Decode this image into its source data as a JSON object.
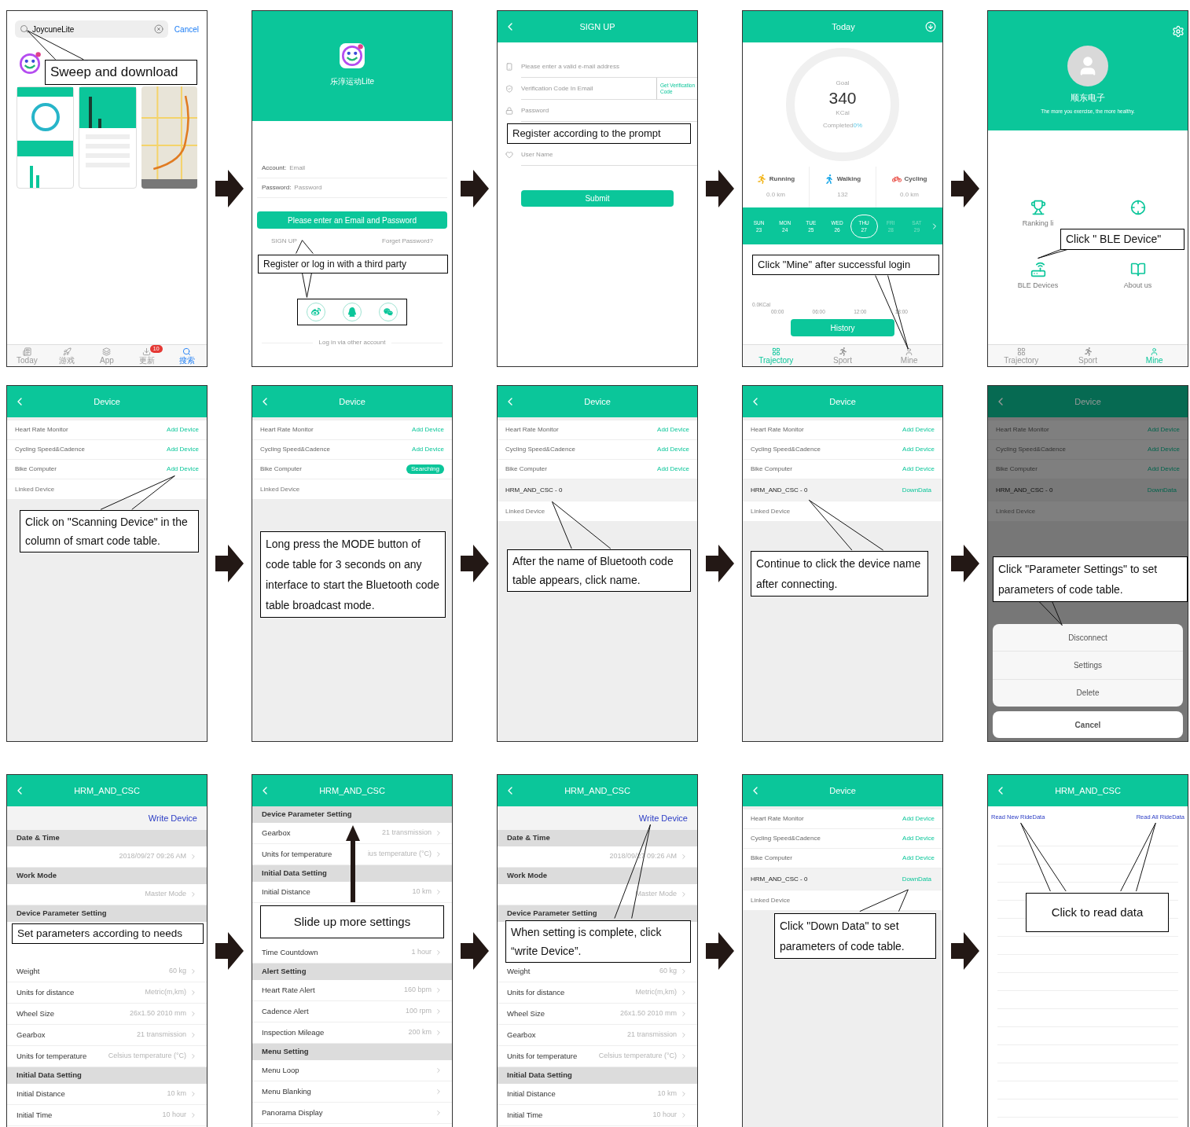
{
  "screens": [
    {
      "kind": "appstore",
      "search": {
        "value": "JoycuneLite"
      },
      "cancel": "Cancel",
      "tabs": [
        {
          "kind": "today",
          "label": "Today",
          "selected": false
        },
        {
          "kind": "games",
          "label": "游戏",
          "selected": false
        },
        {
          "kind": "apps",
          "label": "App",
          "selected": false
        },
        {
          "kind": "updates",
          "label": "更新",
          "badge": "10",
          "selected": false
        },
        {
          "kind": "search",
          "label": "搜索",
          "selected": true
        }
      ],
      "callout": "Sweep and download"
    },
    {
      "kind": "login",
      "app_name": "乐淳运动Lite",
      "fields": [
        {
          "label": "Account:",
          "placeholder": "Email"
        },
        {
          "label": "Password:",
          "placeholder": "Password"
        }
      ],
      "button": "Please enter an Email and Password",
      "links": [
        "SIGN UP",
        "Forget Password?"
      ],
      "footer": "Log in via other account",
      "callout": "Register or log in with a third party"
    },
    {
      "kind": "signup",
      "title": "SIGN UP",
      "fields": [
        {
          "kind": "email",
          "placeholder": "Please enter a valid e-mail address"
        },
        {
          "kind": "code",
          "placeholder": "Verification Code In Email",
          "action": "Get Verification Code"
        },
        {
          "kind": "password",
          "placeholder": "Password"
        },
        {
          "kind": "covered"
        },
        {
          "kind": "name",
          "placeholder": "User Name"
        }
      ],
      "button": "Submit",
      "callout": "Register according to the prompt"
    },
    {
      "kind": "today",
      "title": "Today",
      "goal_label": "Goal",
      "goal": "340",
      "unit": "KCal",
      "completed_label": "Completed",
      "completed": "0%",
      "stats": [
        {
          "kind": "running",
          "label": "Running",
          "value": "0.0 km"
        },
        {
          "kind": "walking",
          "label": "Walking",
          "value": "132"
        },
        {
          "kind": "cycling",
          "label": "Cycling",
          "value": "0.0 km"
        }
      ],
      "days": [
        {
          "day": "SUN",
          "date": "23",
          "selected": false,
          "disabled": false
        },
        {
          "day": "MON",
          "date": "24",
          "selected": false,
          "disabled": false
        },
        {
          "day": "TUE",
          "date": "25",
          "selected": false,
          "disabled": false
        },
        {
          "day": "WED",
          "date": "26",
          "selected": false,
          "disabled": false
        },
        {
          "day": "THU",
          "date": "27",
          "selected": true,
          "disabled": false
        },
        {
          "day": "FRI",
          "date": "28",
          "selected": false,
          "disabled": true
        },
        {
          "day": "SAT",
          "date": "29",
          "selected": false,
          "disabled": true
        }
      ],
      "y_label": "0.0KCal",
      "x_labels": [
        "00:00",
        "06:00",
        "12:00",
        "18:00"
      ],
      "button": "History",
      "tabs": [
        {
          "kind": "trajectory",
          "label": "Trajectory",
          "selected": true
        },
        {
          "kind": "sport",
          "label": "Sport",
          "selected": false
        },
        {
          "kind": "mine",
          "label": "Mine",
          "selected": false
        }
      ],
      "callout": "Click \"Mine\" after successful login"
    },
    {
      "kind": "mine",
      "name": "顺东电子",
      "slogan": "The more you exercise, the more healthy.",
      "items": [
        {
          "kind": "ranking",
          "label": "Ranking li"
        },
        {
          "kind": "target"
        },
        {
          "kind": "ble",
          "label": "BLE Devices"
        },
        {
          "kind": "about",
          "label": "About us"
        }
      ],
      "tabs": [
        {
          "kind": "trajectory",
          "label": "Trajectory",
          "selected": false
        },
        {
          "kind": "sport",
          "label": "Sport",
          "selected": false
        },
        {
          "kind": "mine",
          "label": "Mine",
          "selected": true
        }
      ],
      "callout": "Click \" BLE Device\""
    },
    {
      "kind": "devices",
      "title": "Device",
      "rows": [
        {
          "kind": "sensor",
          "label": "Heart Rate Monitor",
          "action": "Add Device",
          "searching": false
        },
        {
          "kind": "sensor",
          "label": "Cycling Speed&Cadence",
          "action": "Add Device",
          "searching": false
        },
        {
          "kind": "sensor",
          "label": "Bike Computer",
          "action": "Add Device",
          "searching": false
        },
        {
          "kind": "section",
          "label": "Linked Device"
        }
      ],
      "callout": "Click on \"Scanning Device\" in the column of smart code table."
    },
    {
      "kind": "devices",
      "title": "Device",
      "rows": [
        {
          "kind": "sensor",
          "label": "Heart Rate Monitor",
          "action": "Add Device",
          "searching": false
        },
        {
          "kind": "sensor",
          "label": "Cycling Speed&Cadence",
          "action": "Add Device",
          "searching": false
        },
        {
          "kind": "sensor",
          "label": "Bike Computer",
          "action": "Searching",
          "searching": true
        },
        {
          "kind": "section",
          "label": "Linked Device"
        }
      ],
      "callout": "Long press the MODE button of code table for 3 seconds on any interface to start the Bluetooth code table broadcast mode."
    },
    {
      "kind": "devices",
      "title": "Device",
      "rows": [
        {
          "kind": "sensor",
          "label": "Heart Rate Monitor",
          "action": "Add Device",
          "searching": false
        },
        {
          "kind": "sensor",
          "label": "Cycling Speed&Cadence",
          "action": "Add Device",
          "searching": false
        },
        {
          "kind": "sensor",
          "label": "Bike Computer",
          "action": "Add Device",
          "searching": false
        },
        {
          "kind": "device",
          "label": "HRM_AND_CSC - 0"
        },
        {
          "kind": "section",
          "label": "Linked Device"
        }
      ],
      "callout": "After the name of Bluetooth code table appears, click name."
    },
    {
      "kind": "devices",
      "title": "Device",
      "rows": [
        {
          "kind": "sensor",
          "label": "Heart Rate Monitor",
          "action": "Add Device",
          "searching": false
        },
        {
          "kind": "sensor",
          "label": "Cycling Speed&Cadence",
          "action": "Add Device",
          "searching": false
        },
        {
          "kind": "sensor",
          "label": "Bike Computer",
          "action": "Add Device",
          "searching": false
        },
        {
          "kind": "device",
          "label": "HRM_AND_CSC - 0",
          "action": "DownData"
        },
        {
          "kind": "section",
          "label": "Linked Device"
        }
      ],
      "callout": "Continue to click the device name after connecting."
    },
    {
      "kind": "devices",
      "title": "Device",
      "dimmed": true,
      "rows": [
        {
          "kind": "sensor",
          "label": "Heart Rate Monitor",
          "action": "Add Device",
          "searching": false
        },
        {
          "kind": "sensor",
          "label": "Cycling Speed&Cadence",
          "action": "Add Device",
          "searching": false
        },
        {
          "kind": "sensor",
          "label": "Bike Computer",
          "action": "Add Device",
          "searching": false
        },
        {
          "kind": "device",
          "label": "HRM_AND_CSC - 0",
          "action": "DownData"
        },
        {
          "kind": "section",
          "label": "Linked Device"
        }
      ],
      "sheet": {
        "options": [
          "Disconnect",
          "Settings",
          "Delete"
        ],
        "cancel": "Cancel"
      },
      "callout": "Click \"Parameter Settings\" to set parameters of code table."
    },
    {
      "kind": "settings",
      "title": "HRM_AND_CSC",
      "write": "Write Device",
      "rows": [
        {
          "kind": "section",
          "label": "Date & Time"
        },
        {
          "kind": "item",
          "value": "2018/09/27 09:26 AM"
        },
        {
          "kind": "section",
          "label": "Work Mode"
        },
        {
          "kind": "item",
          "value": "Master Mode"
        },
        {
          "kind": "section",
          "label": "Device Parameter Setting"
        },
        {
          "kind": "covered"
        },
        {
          "kind": "item",
          "label": "Weight",
          "value": "60 kg"
        },
        {
          "kind": "item",
          "label": "Units for distance",
          "value": "Metric(m,km)"
        },
        {
          "kind": "item",
          "label": "Wheel Size",
          "value": "26x1.50 2010 mm"
        },
        {
          "kind": "item",
          "label": "Gearbox",
          "value": "21 transmission"
        },
        {
          "kind": "item",
          "label": "Units for temperature",
          "value": "Celsius temperature (°C)"
        },
        {
          "kind": "section",
          "label": "Initial Data Setting"
        },
        {
          "kind": "item",
          "label": "Initial Distance",
          "value": "10 km"
        },
        {
          "kind": "item",
          "label": "Initial Time",
          "value": "10 hour"
        }
      ],
      "callout": "Set parameters according to needs"
    },
    {
      "kind": "settings",
      "title": "HRM_AND_CSC",
      "rows": [
        {
          "kind": "section",
          "label": "Device Parameter Setting"
        },
        {
          "kind": "item",
          "label": "Gearbox",
          "value": "21 transmission"
        },
        {
          "kind": "item",
          "label": "Units for temperature",
          "value": "ius temperature (°C)"
        },
        {
          "kind": "section",
          "label": "Initial Data Setting"
        },
        {
          "kind": "item",
          "label": "Initial Distance",
          "value": "10 km"
        },
        {
          "kind": "covered"
        },
        {
          "kind": "item",
          "label": "Time Countdown",
          "value": "1 hour"
        },
        {
          "kind": "section",
          "label": "Alert Setting"
        },
        {
          "kind": "item",
          "label": "Heart Rate Alert",
          "value": "160 bpm"
        },
        {
          "kind": "item",
          "label": "Cadence Alert",
          "value": "100 rpm"
        },
        {
          "kind": "item",
          "label": "Inspection Mileage",
          "value": "200 km"
        },
        {
          "kind": "section",
          "label": "Menu Setting"
        },
        {
          "kind": "item",
          "label": "Menu Loop"
        },
        {
          "kind": "item",
          "label": "Menu Blanking"
        },
        {
          "kind": "item",
          "label": "Panorama Display"
        }
      ],
      "callout": "Slide up more settings"
    },
    {
      "kind": "settings",
      "title": "HRM_AND_CSC",
      "write": "Write Device",
      "rows": [
        {
          "kind": "section",
          "label": "Date & Time"
        },
        {
          "kind": "item",
          "value": "2018/09/27 09:26 AM"
        },
        {
          "kind": "section",
          "label": "Work Mode"
        },
        {
          "kind": "item",
          "value": "Master Mode"
        },
        {
          "kind": "section",
          "label": "Device Parameter Setting"
        },
        {
          "kind": "covered"
        },
        {
          "kind": "item",
          "label": "Weight",
          "value": "60 kg"
        },
        {
          "kind": "item",
          "label": "Units for distance",
          "value": "Metric(m,km)"
        },
        {
          "kind": "item",
          "label": "Wheel Size",
          "value": "26x1.50 2010 mm"
        },
        {
          "kind": "item",
          "label": "Gearbox",
          "value": "21 transmission"
        },
        {
          "kind": "item",
          "label": "Units for temperature",
          "value": "Celsius temperature (°C)"
        },
        {
          "kind": "section",
          "label": "Initial Data Setting"
        },
        {
          "kind": "item",
          "label": "Initial Distance",
          "value": "10 km"
        },
        {
          "kind": "item",
          "label": "Initial Time",
          "value": "10 hour"
        }
      ],
      "callout": "When setting is complete, click “write Device”."
    },
    {
      "kind": "devices",
      "title": "Device",
      "rows": [
        {
          "kind": "sensor",
          "label": "Heart Rate Monitor",
          "action": "Add Device",
          "searching": false
        },
        {
          "kind": "sensor",
          "label": "Cycling Speed&Cadence",
          "action": "Add Device",
          "searching": false
        },
        {
          "kind": "sensor",
          "label": "Bike Computer",
          "action": "Add Device",
          "searching": false
        },
        {
          "kind": "device",
          "label": "HRM_AND_CSC - 0",
          "action": "DownData"
        },
        {
          "kind": "section",
          "label": "Linked Device"
        }
      ],
      "callout": "Click \"Down Data\" to set parameters of code table."
    },
    {
      "kind": "ridedata",
      "title": "HRM_AND_CSC",
      "links": [
        "Read New RideData",
        "Read All RideData"
      ],
      "callout": "Click to read data"
    }
  ]
}
